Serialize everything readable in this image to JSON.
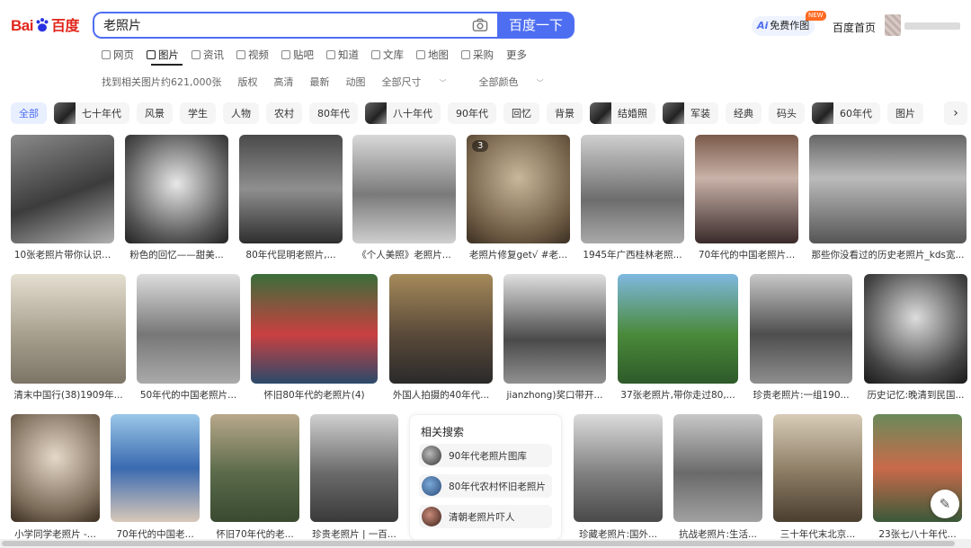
{
  "logo": {
    "text_left": "Bai",
    "text_right": "百度"
  },
  "search": {
    "query": "老照片",
    "button_label": "百度一下"
  },
  "header": {
    "ai_label": "免费作图",
    "ai_prefix": "Ai",
    "new_badge": "NEW",
    "home_label": "百度首页"
  },
  "nav": {
    "tabs": [
      {
        "label": "网页",
        "active": false
      },
      {
        "label": "图片",
        "active": true
      },
      {
        "label": "资讯",
        "active": false
      },
      {
        "label": "视频",
        "active": false
      },
      {
        "label": "贴吧",
        "active": false
      },
      {
        "label": "知道",
        "active": false
      },
      {
        "label": "文库",
        "active": false
      },
      {
        "label": "地图",
        "active": false
      },
      {
        "label": "采购",
        "active": false
      },
      {
        "label": "更多",
        "active": false
      }
    ]
  },
  "filters": {
    "result_count": "找到相关图片约621,000张",
    "items": [
      "版权",
      "高清",
      "最新",
      "动图",
      "全部尺寸",
      "全部颜色"
    ]
  },
  "categories": [
    {
      "label": "全部",
      "active": true,
      "thumb": false
    },
    {
      "label": "七十年代",
      "thumb": true
    },
    {
      "label": "风景",
      "thumb": false
    },
    {
      "label": "学生",
      "thumb": false
    },
    {
      "label": "人物",
      "thumb": false
    },
    {
      "label": "农村",
      "thumb": false
    },
    {
      "label": "80年代",
      "thumb": false
    },
    {
      "label": "八十年代",
      "thumb": true
    },
    {
      "label": "90年代",
      "thumb": false
    },
    {
      "label": "回忆",
      "thumb": false
    },
    {
      "label": "背景",
      "thumb": false
    },
    {
      "label": "结婚照",
      "thumb": true
    },
    {
      "label": "军装",
      "thumb": true
    },
    {
      "label": "经典",
      "thumb": false
    },
    {
      "label": "码头",
      "thumb": false
    },
    {
      "label": "60年代",
      "thumb": true
    },
    {
      "label": "图片",
      "thumb": false
    }
  ],
  "results": {
    "row1": [
      "10张老照片带你认识...",
      "粉色的回忆——甜美...",
      "80年代昆明老照片,...",
      "《个人美照》老照片...",
      "老照片修复get√ #老...",
      "1945年广西桂林老照...",
      "70年代的中国老照片...",
      "那些你没看过的历史老照片_kds宽..."
    ],
    "row2": [
      "清末中国行(38)1909年...",
      "50年代的中国老照片...",
      "怀旧80年代的老照片(4)",
      "外国人拍摄的40年代...",
      "jianzhong)奖口带开...",
      "37张老照片,带你走过80,...",
      "珍贵老照片:一组190...",
      "历史记忆:晚清到民国..."
    ],
    "row3": [
      "小学同学老照片 -...",
      "70年代的中国老...",
      "怀旧70年代的老...",
      "珍贵老照片 | 一百...",
      "珍藏老照片:国外...",
      "抗战老照片:生活...",
      "三十年代末北京...",
      "23张七八十年代..."
    ],
    "badge_count": "3"
  },
  "related": {
    "title": "相关搜索",
    "items": [
      "90年代老照片图库",
      "80年代农村怀旧老照片",
      "清朝老照片吓人"
    ]
  },
  "colors": {
    "accent": "#4e6ef2",
    "logo_red": "#e1261c"
  }
}
